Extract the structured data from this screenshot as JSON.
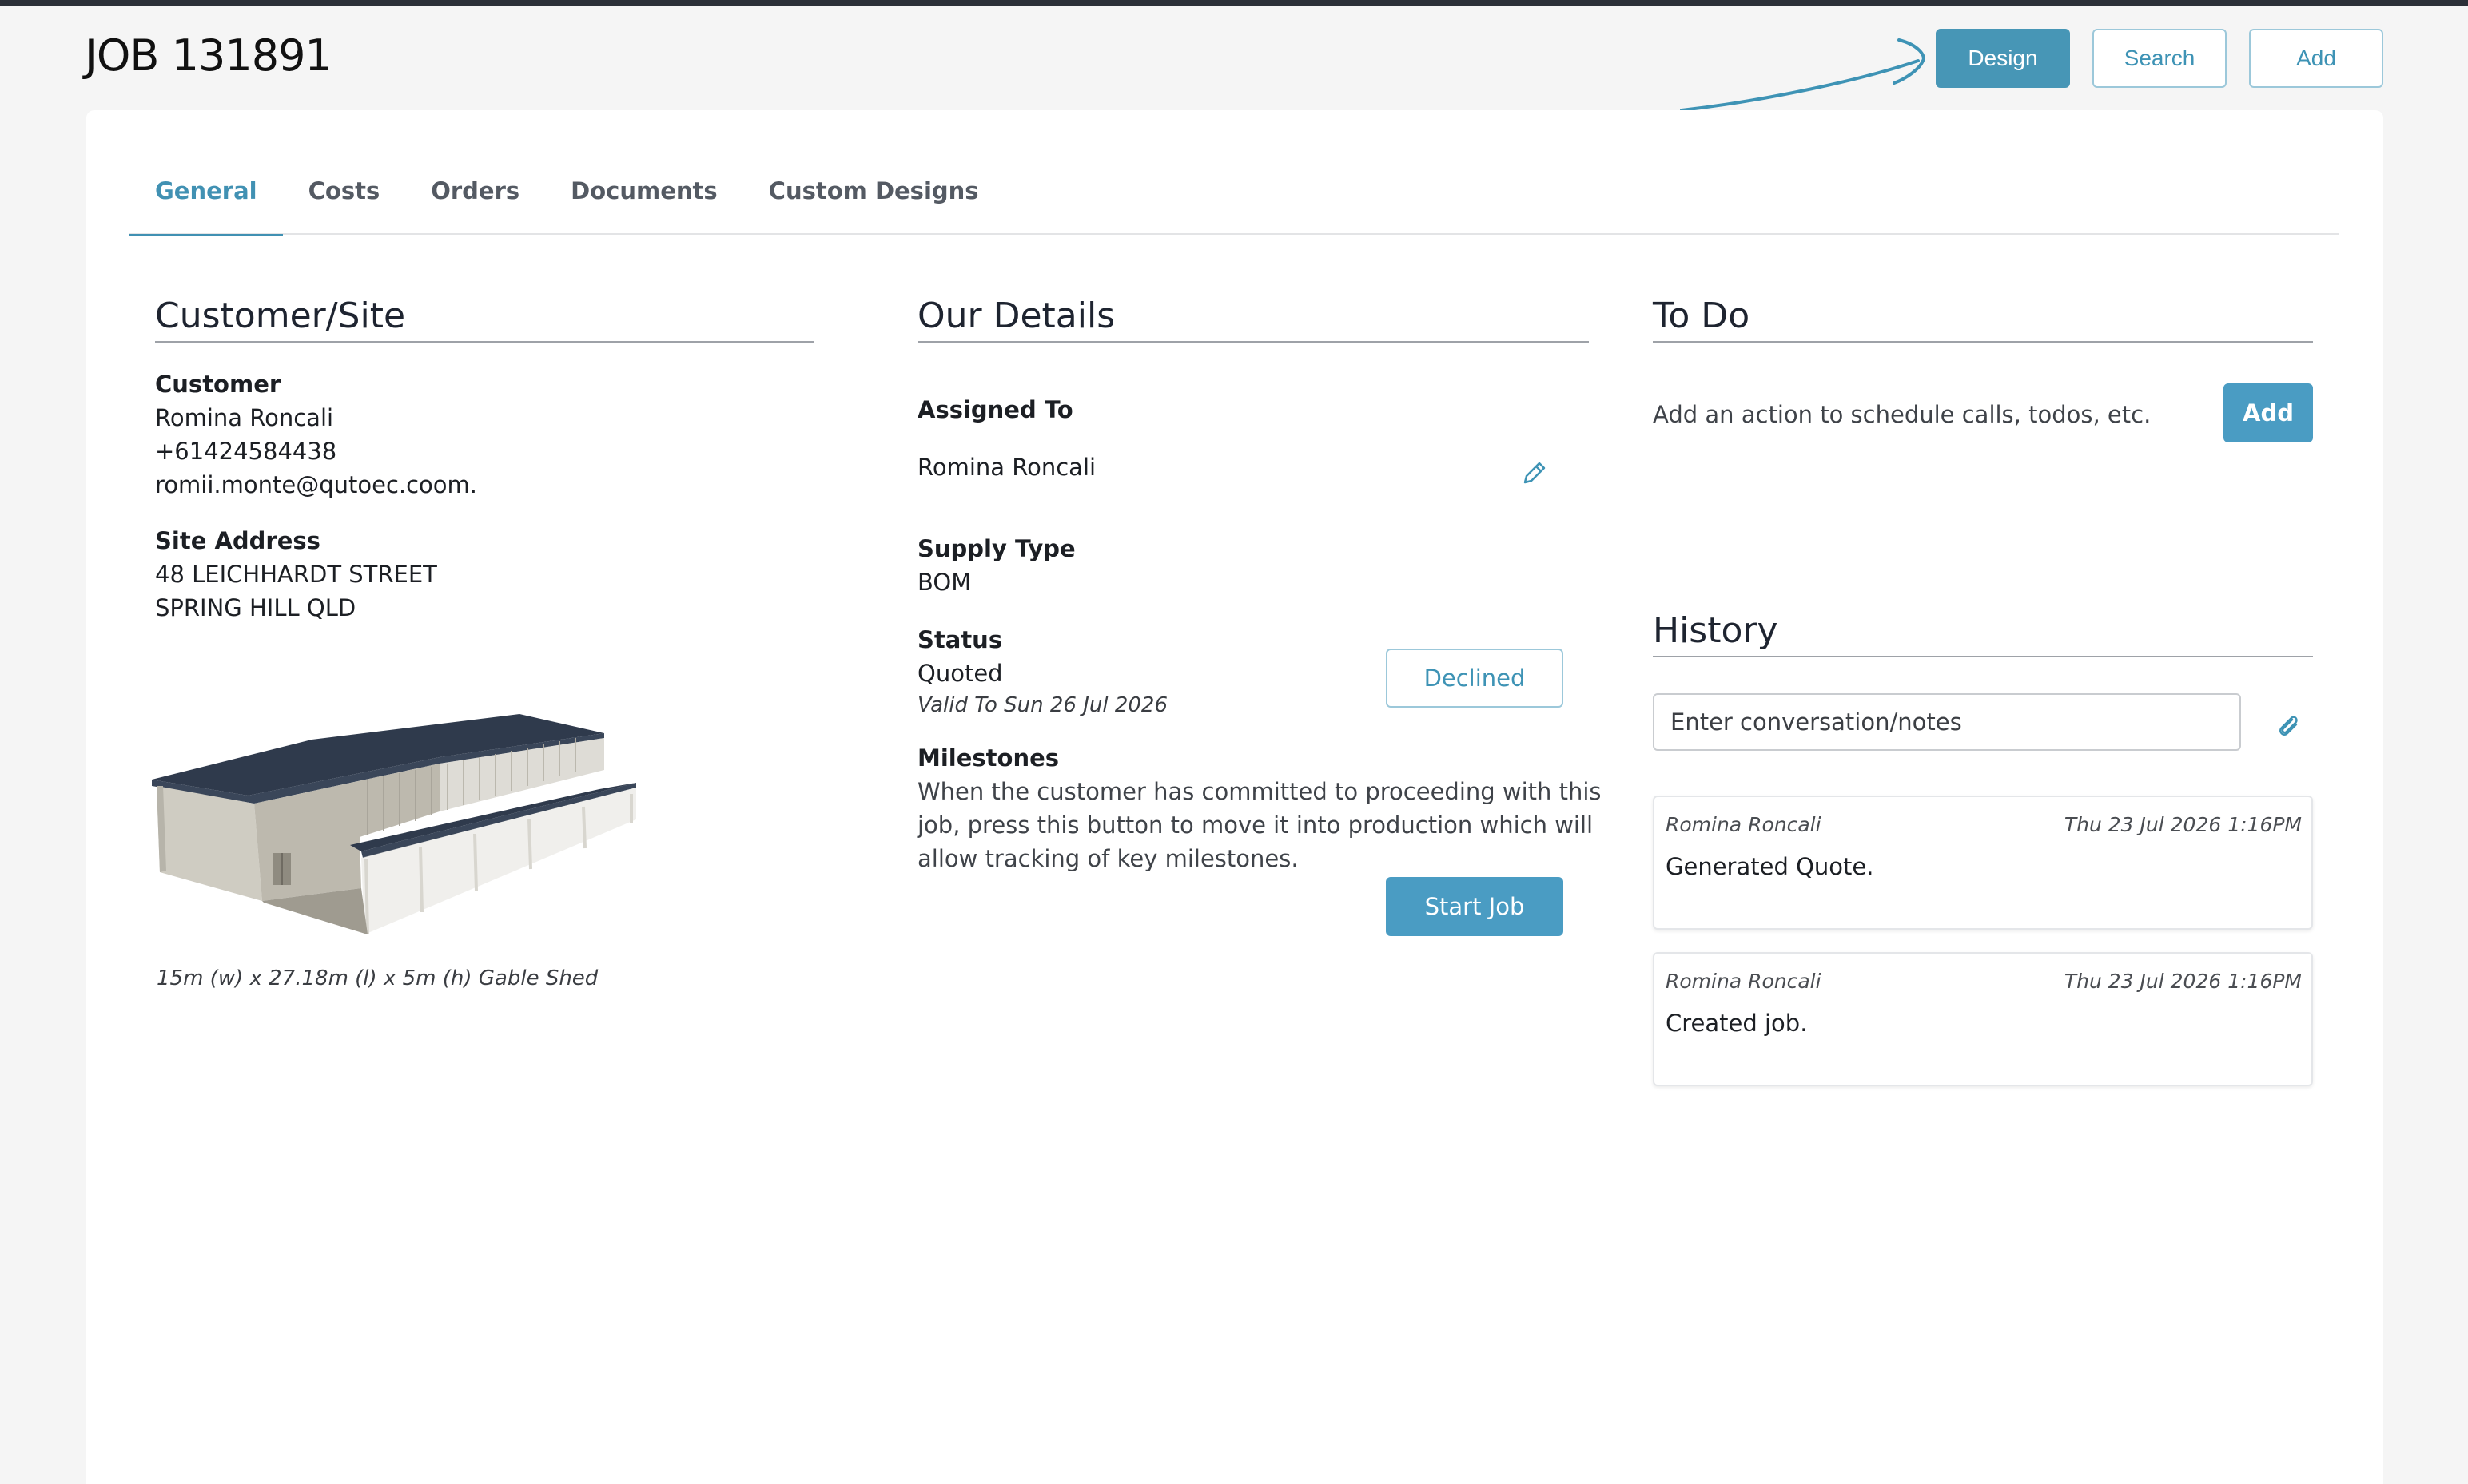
{
  "header": {
    "title": "JOB 131891",
    "buttons": {
      "design": "Design",
      "search": "Search",
      "add": "Add"
    }
  },
  "tabs": [
    "General",
    "Costs",
    "Orders",
    "Documents",
    "Custom Designs"
  ],
  "customer_site": {
    "title": "Customer/Site",
    "customer_label": "Customer",
    "customer_name": "Romina Roncali",
    "phone": "+61424584438",
    "email": "romii.monte@qutoec.coom.",
    "site_label": "Site Address",
    "address_line1": "48 LEICHHARDT STREET",
    "address_line2": "SPRING HILL QLD",
    "shed_caption": "15m (w) x 27.18m (l) x 5m (h) Gable Shed"
  },
  "our_details": {
    "title": "Our Details",
    "assigned_label": "Assigned To",
    "assigned_value": "Romina Roncali",
    "supply_label": "Supply Type",
    "supply_value": "BOM",
    "status_label": "Status",
    "status_value": "Quoted",
    "valid_to": "Valid To Sun 26 Jul 2026",
    "declined_button": "Declined",
    "milestones_label": "Milestones",
    "milestones_line1": "When the customer has committed to proceeding with this",
    "milestones_line2": "job, press this button to move it into production which will",
    "milestones_line3": "allow tracking of key milestones.",
    "start_job_button": "Start Job"
  },
  "todo": {
    "title": "To Do",
    "hint": "Add an action to schedule calls, todos, etc.",
    "add_button": "Add"
  },
  "history": {
    "title": "History",
    "input_placeholder": "Enter conversation/notes",
    "items": [
      {
        "user": "Romina Roncali",
        "time": "Thu 23 Jul 2026 1:16PM",
        "message": "Generated Quote."
      },
      {
        "user": "Romina Roncali",
        "time": "Thu 23 Jul 2026 1:16PM",
        "message": "Created job."
      }
    ]
  },
  "icons": {
    "edit": "pencil-icon",
    "attach": "paperclip-icon",
    "annotation": "arrow-annotation-icon"
  },
  "colors": {
    "accent": "#4796b6",
    "accent_light_border": "#9cc8da",
    "top_strip": "#2c3038"
  }
}
